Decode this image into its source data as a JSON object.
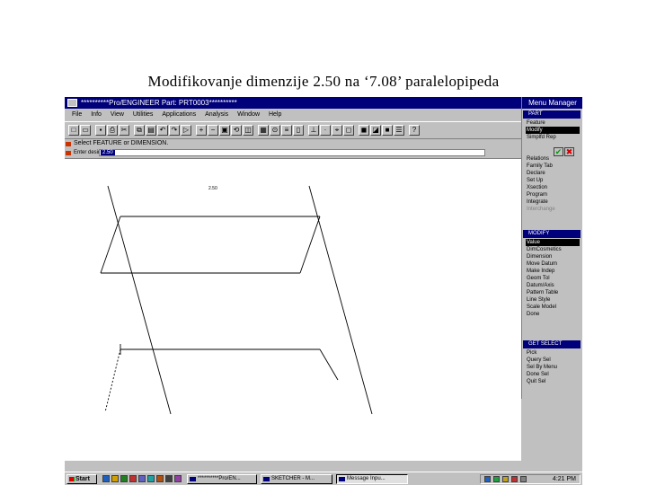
{
  "slide_title": "Modifikovanje dimenzije  2.50  na ‘7.08’  paralelopipeda",
  "window": {
    "title": "**********Pro/ENGINEER Part: PRT0003**********",
    "menus": [
      "File",
      "Info",
      "View",
      "Utilities",
      "Applications",
      "Analysis",
      "Window",
      "Help"
    ]
  },
  "toolbar": {
    "icons": [
      "new-icon",
      "open-icon",
      "save-icon",
      "print-icon",
      "cut-icon",
      "copy-icon",
      "paste-icon",
      "undo-icon",
      "redo-icon",
      "select-icon",
      "zoom-in-icon",
      "zoom-out-icon",
      "refit-icon",
      "reorient-icon",
      "repaint-icon",
      "saved-view-icon",
      "spin-center-icon",
      "layers-icon",
      "datum-plane-icon",
      "datum-axis-icon",
      "datum-point-icon",
      "csys-icon",
      "wireframe-icon",
      "hidden-line-icon",
      "no-hidden-icon",
      "shade-icon",
      "model-tree-icon",
      "help-icon"
    ]
  },
  "message": "Select FEATURE or DIMENSION.",
  "entry": {
    "label": "Enter desired",
    "value": "2.50"
  },
  "graphics": {
    "dimension_label": "2.50"
  },
  "menu_manager": {
    "title": "Menu Manager",
    "part": {
      "header": "PART",
      "items": [
        {
          "label": "Feature",
          "state": "normal"
        },
        {
          "label": "Modify",
          "state": "selected"
        },
        {
          "label": "Simplfd Rep",
          "state": "normal"
        },
        {
          "label": "Relations",
          "state": "normal"
        },
        {
          "label": "Family Tab",
          "state": "normal"
        },
        {
          "label": "Declare",
          "state": "normal"
        },
        {
          "label": "Set Up",
          "state": "normal"
        },
        {
          "label": "Xsection",
          "state": "normal"
        },
        {
          "label": "Program",
          "state": "normal"
        },
        {
          "label": "Integrate",
          "state": "normal"
        },
        {
          "label": "Interchange",
          "state": "disabled"
        }
      ]
    },
    "modify": {
      "header": "MODIFY",
      "items": [
        {
          "label": "Value",
          "state": "selected"
        },
        {
          "label": "DimCosmetics",
          "state": "normal"
        },
        {
          "label": "Dimension",
          "state": "normal"
        },
        {
          "label": "Move Datum",
          "state": "normal"
        },
        {
          "label": "Make Indep",
          "state": "normal"
        },
        {
          "label": "Geom Tol",
          "state": "normal"
        },
        {
          "label": "Datum/Axis",
          "state": "normal"
        },
        {
          "label": "Pattern Table",
          "state": "normal"
        },
        {
          "label": "Line Style",
          "state": "normal"
        },
        {
          "label": "Scale Model",
          "state": "normal"
        },
        {
          "label": "Done",
          "state": "normal"
        }
      ]
    },
    "get_select": {
      "header": "GET SELECT",
      "items": [
        {
          "label": "Pick",
          "state": "normal"
        },
        {
          "label": "Query Sel",
          "state": "normal"
        },
        {
          "label": "Sel By Menu",
          "state": "normal"
        },
        {
          "label": "Done Sel",
          "state": "normal"
        },
        {
          "label": "Quit Sel",
          "state": "normal"
        }
      ]
    },
    "ok_icon": "check-icon",
    "cancel_icon": "x-icon"
  },
  "taskbar": {
    "start_label": "Start",
    "quick_launch": [
      "quick-icon-1",
      "quick-icon-2",
      "quick-icon-3",
      "quick-icon-4",
      "quick-icon-5",
      "quick-icon-6",
      "quick-icon-7",
      "quick-icon-8",
      "quick-icon-9"
    ],
    "tasks": [
      {
        "label": "**********Pro/EN...",
        "active": false
      },
      {
        "label": "SKETCHER - M...",
        "active": false
      },
      {
        "label": "Message Inpu...",
        "active": true
      }
    ],
    "clock": "4:21 PM"
  }
}
